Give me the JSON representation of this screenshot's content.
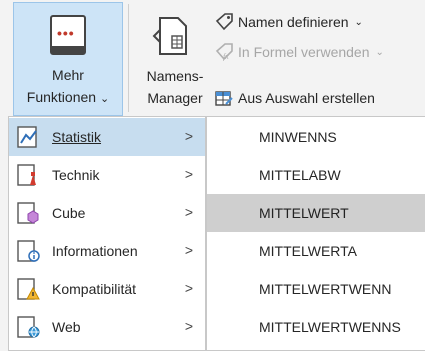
{
  "ribbon": {
    "more_functions": {
      "line1": "Mehr",
      "line2": "Funktionen",
      "caret": "⌄"
    },
    "name_manager": {
      "line1": "Namens-",
      "line2": "Manager"
    },
    "define_name": {
      "label": "Namen definieren",
      "caret": "⌄"
    },
    "use_in_formula": {
      "label": "In Formel verwenden",
      "caret": "⌄"
    },
    "create_from_selection": {
      "label": "Aus Auswahl erstellen"
    }
  },
  "menu": {
    "items": [
      {
        "label": "Statistik",
        "icon": "statistics-icon",
        "arrow": ">"
      },
      {
        "label": "Technik",
        "icon": "engineering-icon",
        "arrow": ">"
      },
      {
        "label": "Cube",
        "icon": "cube-icon",
        "arrow": ">"
      },
      {
        "label": "Informationen",
        "icon": "information-icon",
        "arrow": ">"
      },
      {
        "label": "Kompatibilität",
        "icon": "compatibility-icon",
        "arrow": ">"
      },
      {
        "label": "Web",
        "icon": "web-icon",
        "arrow": ">"
      }
    ]
  },
  "submenu": {
    "items": [
      "MINWENNS",
      "MITTELABW",
      "MITTELWERT",
      "MITTELWERTA",
      "MITTELWERTWENN",
      "MITTELWERTWENNS"
    ],
    "highlighted": "MITTELWERT"
  },
  "colors": {
    "active_item": "#c7ddef",
    "button_active": "#cde4f7",
    "highlight": "#cfcfcf"
  }
}
